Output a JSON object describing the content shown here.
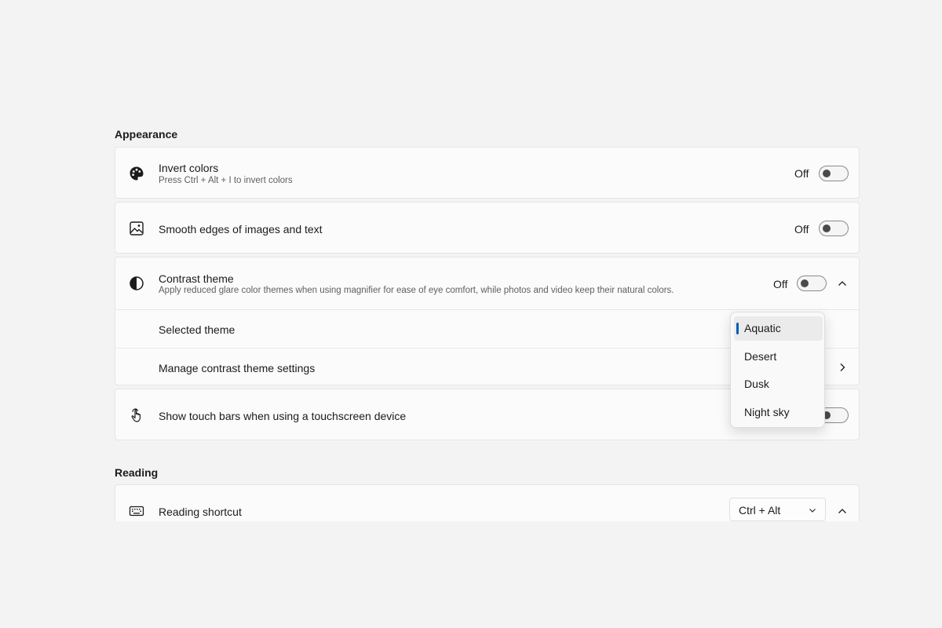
{
  "sections": {
    "appearance": {
      "title": "Appearance"
    },
    "reading": {
      "title": "Reading"
    }
  },
  "invert_colors": {
    "title": "Invert colors",
    "subtitle": "Press Ctrl + Alt + I to invert colors",
    "state": "Off"
  },
  "smooth_edges": {
    "title": "Smooth edges of images and text",
    "state": "Off"
  },
  "contrast_theme": {
    "title": "Contrast theme",
    "subtitle": "Apply reduced glare color themes when using magnifier for ease of eye comfort, while photos and video keep their natural colors.",
    "state": "Off",
    "selected_theme_label": "Selected theme",
    "manage_label": "Manage contrast theme settings"
  },
  "theme_dropdown": {
    "options": [
      "Aquatic",
      "Desert",
      "Dusk",
      "Night sky"
    ],
    "selected": "Aquatic"
  },
  "touch_bars": {
    "title": "Show touch bars when using a touchscreen device"
  },
  "reading_shortcut": {
    "title": "Reading shortcut",
    "value": "Ctrl + Alt"
  },
  "colors": {
    "accent": "#005fb8",
    "background": "#f3f3f3",
    "card": "#fbfbfb"
  }
}
